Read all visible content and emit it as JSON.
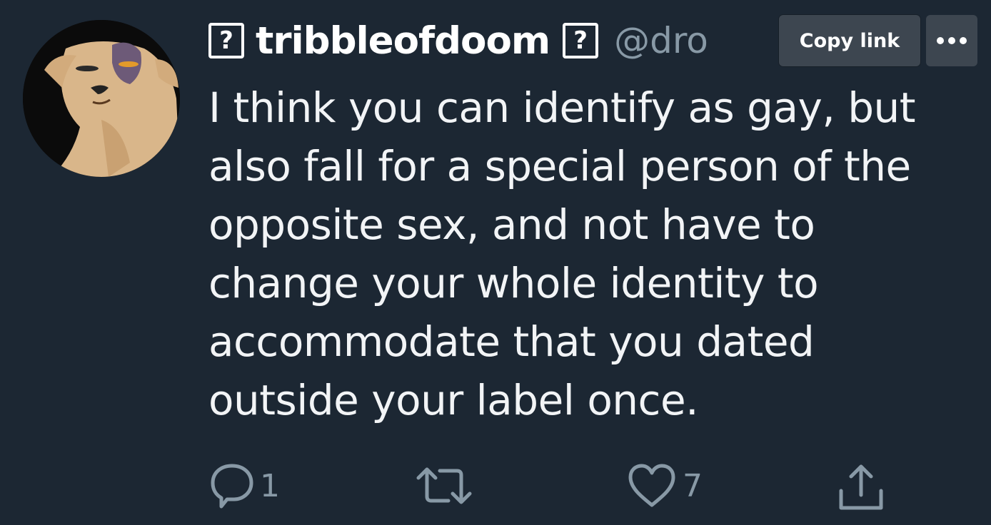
{
  "user": {
    "display_name": "tribbleofdoom",
    "handle": "@dro",
    "badge_glyph": "?"
  },
  "context_menu": {
    "copy_link_label": "Copy link",
    "more_icon": "ellipsis-icon"
  },
  "tweet": {
    "lines": [
      "I think you can identify as gay, but",
      "also fall for a special person of the",
      "opposite sex, and not have to",
      "change your whole identity to",
      "accommodate that you dated",
      "outside your label once."
    ]
  },
  "actions": {
    "reply_count": "1",
    "retweet_count": "",
    "like_count": "7"
  },
  "colors": {
    "background": "#1c2733",
    "text": "#f2f4f6",
    "secondary": "#8899a6",
    "menu_bg": "#3d4650"
  }
}
